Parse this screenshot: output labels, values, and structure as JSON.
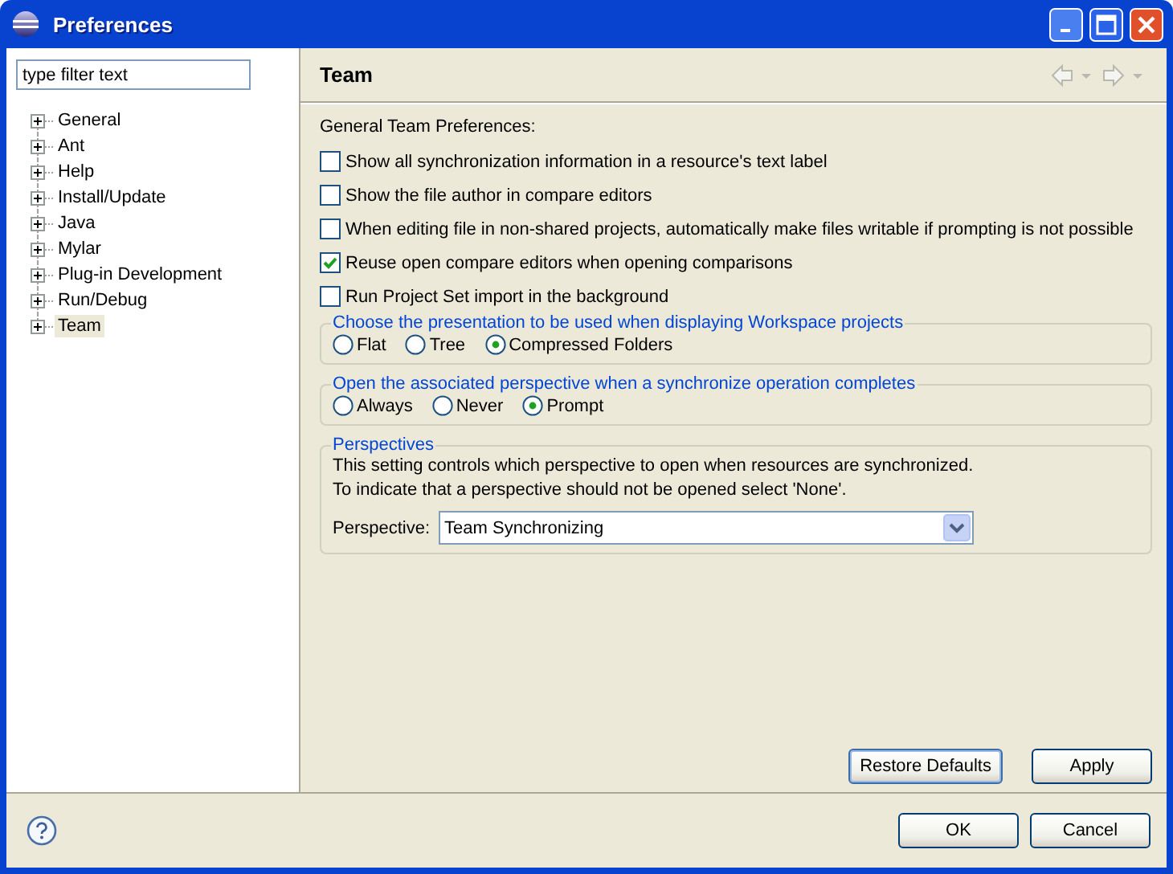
{
  "window": {
    "title": "Preferences"
  },
  "filter": {
    "value": "type filter text"
  },
  "tree": [
    {
      "label": "General",
      "expanded": false,
      "selected": false
    },
    {
      "label": "Ant",
      "expanded": false,
      "selected": false
    },
    {
      "label": "Help",
      "expanded": false,
      "selected": false
    },
    {
      "label": "Install/Update",
      "expanded": false,
      "selected": false
    },
    {
      "label": "Java",
      "expanded": false,
      "selected": false
    },
    {
      "label": "Mylar",
      "expanded": false,
      "selected": false
    },
    {
      "label": "Plug-in Development",
      "expanded": false,
      "selected": false
    },
    {
      "label": "Run/Debug",
      "expanded": false,
      "selected": false
    },
    {
      "label": "Team",
      "expanded": false,
      "selected": true
    }
  ],
  "page": {
    "title": "Team",
    "intro": "General Team Preferences:",
    "options": [
      {
        "label": "Show all synchronization information in a resource's text label",
        "checked": false
      },
      {
        "label": "Show the file author in compare editors",
        "checked": false
      },
      {
        "label": "When editing file in non-shared projects, automatically make files writable if prompting is not possible",
        "checked": false
      },
      {
        "label": "Reuse open compare editors when opening comparisons",
        "checked": true
      },
      {
        "label": "Run Project Set import in the background",
        "checked": false
      }
    ],
    "groups": [
      {
        "title": "Choose the presentation to be used when displaying Workspace projects",
        "choices": [
          {
            "label": "Flat",
            "selected": false
          },
          {
            "label": "Tree",
            "selected": false
          },
          {
            "label": "Compressed Folders",
            "selected": true
          }
        ]
      },
      {
        "title": "Open the associated perspective when a synchronize operation completes",
        "choices": [
          {
            "label": "Always",
            "selected": false
          },
          {
            "label": "Never",
            "selected": false
          },
          {
            "label": "Prompt",
            "selected": true
          }
        ]
      }
    ],
    "perspectives": {
      "title": "Perspectives",
      "description": [
        "This setting controls which perspective to open when resources are synchronized.",
        "To indicate that a perspective should not be opened select 'None'."
      ],
      "label": "Perspective:",
      "value": "Team Synchronizing"
    },
    "buttons": [
      "Restore Defaults",
      "Apply"
    ]
  },
  "dialog_buttons": [
    "OK",
    "Cancel"
  ]
}
